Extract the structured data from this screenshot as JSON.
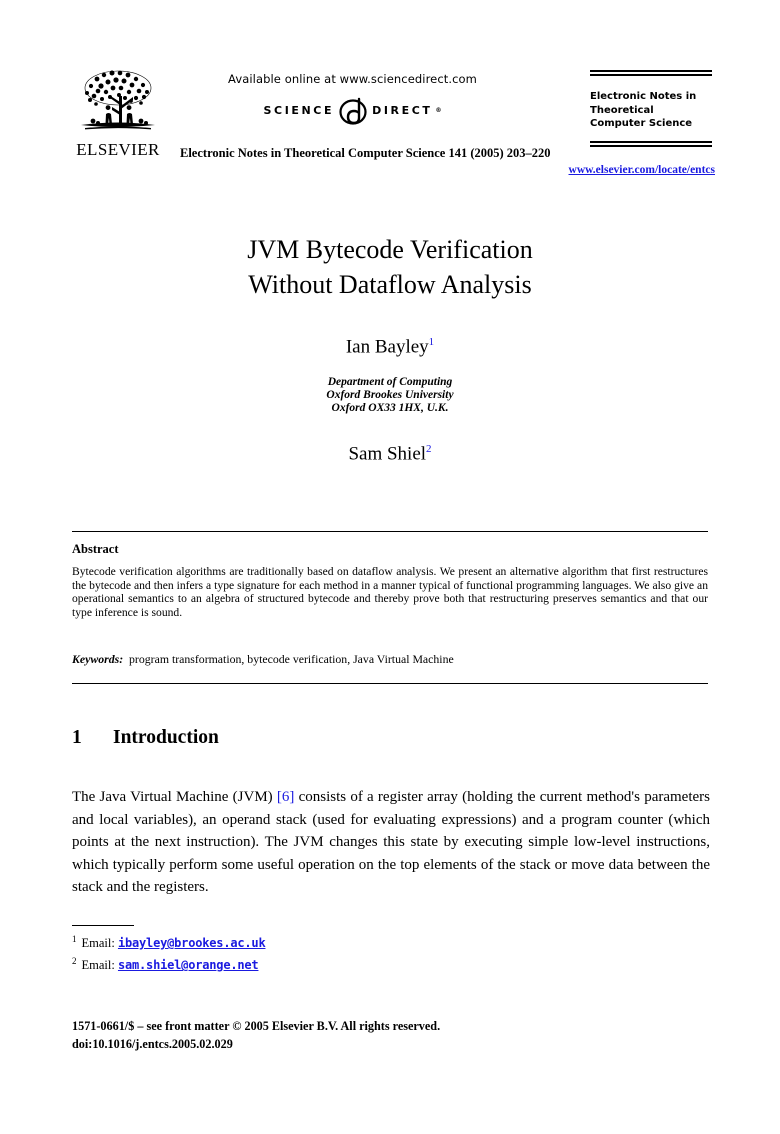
{
  "header": {
    "publisher_logo_name": "ELSEVIER",
    "available_online": "Available online at www.sciencedirect.com",
    "sciencedirect": {
      "left_word": "SCIENCE",
      "right_word": "DIRECT",
      "registered_mark": "®"
    },
    "journal_reference": "Electronic Notes in Theoretical Computer Science 141 (2005) 203–220",
    "entcs_title": "Electronic Notes in Theoretical Computer Science",
    "entcs_url": "www.elsevier.com/locate/entcs"
  },
  "article": {
    "title_line1": "JVM Bytecode Verification",
    "title_line2": "Without Dataflow Analysis",
    "authors": [
      {
        "name": "Ian Bayley",
        "footnote_mark": "1"
      },
      {
        "name": "Sam Shiel",
        "footnote_mark": "2"
      }
    ],
    "affiliation_line1": "Department of Computing",
    "affiliation_line2": "Oxford Brookes University",
    "affiliation_line3": "Oxford OX33 1HX, U.K."
  },
  "abstract": {
    "heading": "Abstract",
    "text": "Bytecode verification algorithms are traditionally based on dataflow analysis. We present an alternative algorithm that first restructures the bytecode and then infers a type signature for each method in a manner typical of functional programming languages. We also give an operational semantics to an algebra of structured bytecode and thereby prove both that restructuring preserves semantics and that our type inference is sound.",
    "keywords_label": "Keywords:",
    "keywords_value": "program transformation, bytecode verification, Java Virtual Machine"
  },
  "section": {
    "number": "1",
    "heading": "Introduction",
    "paragraph_before_cite": "The Java Virtual Machine (JVM) ",
    "cite_open": "[",
    "cite_number": "6",
    "cite_close": "]",
    "paragraph_after_cite": " consists of a register array (holding the current method's parameters and local variables), an operand stack (used for evaluating expressions) and a program counter (which points at the next instruction). The JVM changes this state by executing simple low-level instructions, which typically perform some useful operation on the top elements of the stack or move data between the stack and the registers."
  },
  "footnotes": [
    {
      "mark": "1",
      "label": "Email:",
      "email": "ibayley@brookes.ac.uk"
    },
    {
      "mark": "2",
      "label": "Email:",
      "email": "sam.shiel@orange.net"
    }
  ],
  "copyright": {
    "line1": "1571-0661/$ – see front matter © 2005 Elsevier B.V. All rights reserved.",
    "line2": "doi:10.1016/j.entcs.2005.02.029"
  },
  "colors": {
    "link": "#1a1ae0",
    "text": "#000000",
    "background": "#ffffff"
  }
}
